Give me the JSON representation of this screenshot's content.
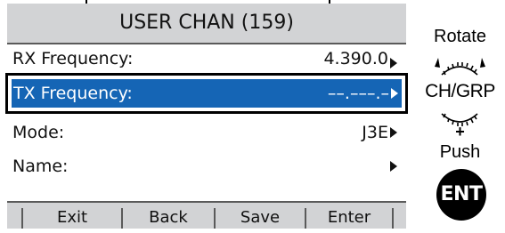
{
  "screen": {
    "title": "USER CHAN (159)",
    "rows": [
      {
        "label": "RX Frequency:",
        "value": "4.390.0"
      },
      {
        "label": "TX Frequency:",
        "value": "––.–––.–",
        "selected": true
      },
      {
        "label": "Mode:",
        "value": "J3E"
      },
      {
        "label": "Name:",
        "value": ""
      }
    ],
    "softkeys": [
      "Exit",
      "Back",
      "Save",
      "Enter"
    ]
  },
  "controls": {
    "rotate_label": "Rotate",
    "knob_label": "CH/GRP",
    "plus": "+",
    "push_label": "Push",
    "ent_label": "ENT"
  },
  "colors": {
    "selection": "#1565b5",
    "screen_bg": "#d2d3d5",
    "panel_bg": "#ffffff"
  }
}
